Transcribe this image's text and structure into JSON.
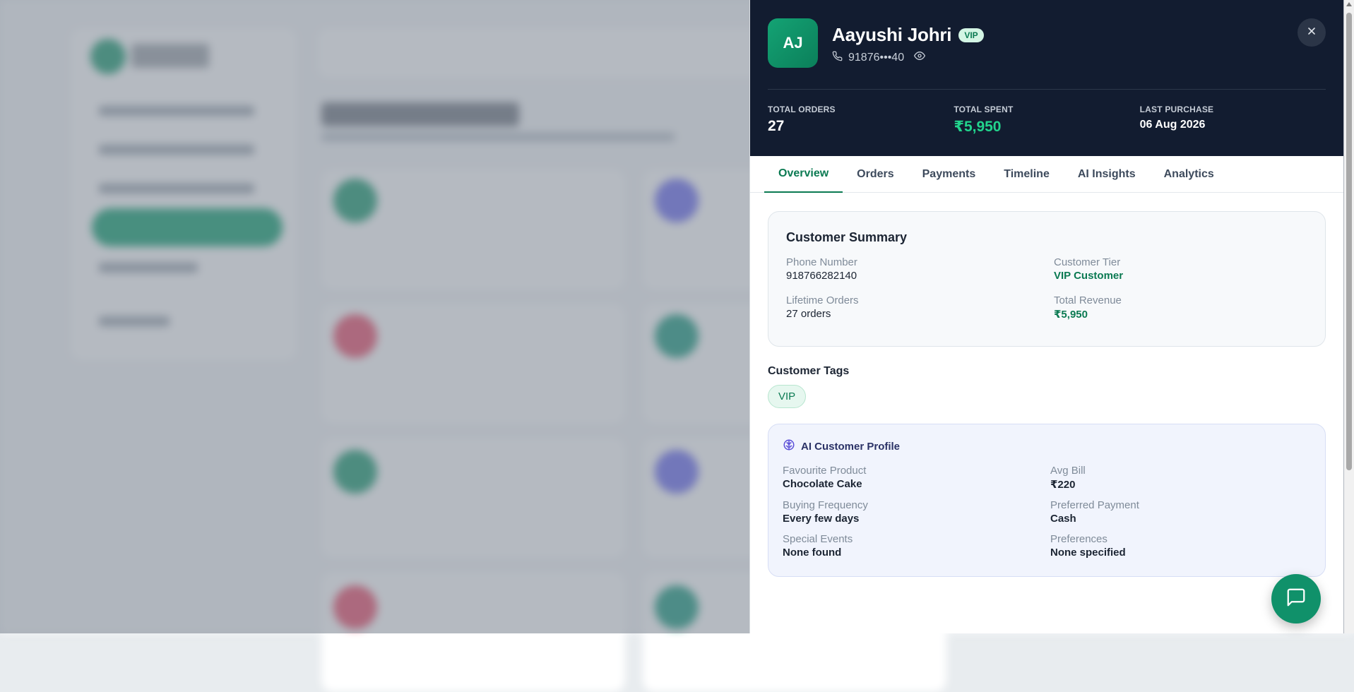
{
  "customer": {
    "initials": "AJ",
    "name": "Aayushi Johri",
    "badge": "VIP",
    "phone_masked": "91876•••40"
  },
  "stats": [
    {
      "label": "TOTAL ORDERS",
      "value": "27"
    },
    {
      "label": "TOTAL SPENT",
      "value": "₹5,950"
    },
    {
      "label": "LAST PURCHASE",
      "value": "06 Aug 2026"
    }
  ],
  "tabs": [
    "Overview",
    "Orders",
    "Payments",
    "Timeline",
    "AI Insights",
    "Analytics"
  ],
  "active_tab": "Overview",
  "summary": {
    "title": "Customer Summary",
    "fields": [
      {
        "label": "Phone Number",
        "value": "918766282140"
      },
      {
        "label": "Customer Tier",
        "value": "VIP Customer"
      },
      {
        "label": "Lifetime Orders",
        "value": "27 orders"
      },
      {
        "label": "Total Revenue",
        "value": "₹5,950"
      }
    ]
  },
  "tags": {
    "title": "Customer Tags",
    "items": [
      "VIP"
    ]
  },
  "ai_profile": {
    "title": "AI Customer Profile",
    "fields": [
      {
        "label": "Favourite Product",
        "value": "Chocolate Cake"
      },
      {
        "label": "Avg Bill",
        "value": "₹220"
      },
      {
        "label": "Buying Frequency",
        "value": "Every few days"
      },
      {
        "label": "Preferred Payment",
        "value": "Cash"
      },
      {
        "label": "Special Events",
        "value": "None found"
      },
      {
        "label": "Preferences",
        "value": "None specified"
      }
    ]
  },
  "colors": {
    "header_bg": "#121c30",
    "accent_green": "#0b7a52",
    "stat_green": "#22d38c"
  },
  "icons": {
    "phone": "phone-icon",
    "eye": "eye-icon",
    "close": "close-icon",
    "brain": "brain-icon",
    "chat": "chat-icon"
  }
}
